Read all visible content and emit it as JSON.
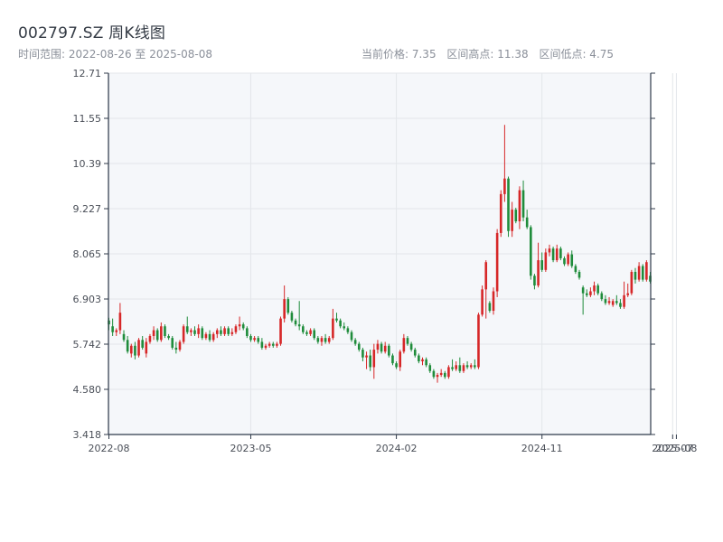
{
  "title": "002797.SZ 周K线图",
  "subtitle": {
    "range_label": "时间范围: 2022-08-26 至 2025-08-08",
    "current_price": "当前价格: 7.35",
    "high": "区间高点: 11.38",
    "low": "区间低点: 4.75"
  },
  "colors": {
    "up": "#d62728",
    "down": "#1f8c3b",
    "plot_bg": "#f5f7fa",
    "grid": "#e3e6ea",
    "axis": "#2f3a4a"
  },
  "chart_data": {
    "type": "candlestick",
    "grid": true,
    "ylim": [
      3.418,
      12.71
    ],
    "y_ticks": [
      "3.418",
      "4.580",
      "5.742",
      "6.903",
      "8.065",
      "9.227",
      "10.39",
      "11.55",
      "12.71"
    ],
    "x_ticks": [
      "2022-08",
      "2023-05",
      "2024-02",
      "2024-11",
      "2025-07",
      "2025-08"
    ],
    "x_tick_weeks": [
      0,
      38,
      77,
      116,
      151,
      152
    ],
    "candles": [
      {
        "o": 6.35,
        "h": 6.42,
        "l": 6.1,
        "c": 6.25
      },
      {
        "o": 6.2,
        "h": 6.4,
        "l": 5.95,
        "c": 6.05
      },
      {
        "o": 6.05,
        "h": 6.15,
        "l": 5.95,
        "c": 6.1
      },
      {
        "o": 6.1,
        "h": 6.8,
        "l": 6.0,
        "c": 6.55
      },
      {
        "o": 6.0,
        "h": 6.1,
        "l": 5.8,
        "c": 5.85
      },
      {
        "o": 5.85,
        "h": 5.95,
        "l": 5.5,
        "c": 5.55
      },
      {
        "o": 5.5,
        "h": 5.75,
        "l": 5.4,
        "c": 5.7
      },
      {
        "o": 5.7,
        "h": 5.8,
        "l": 5.35,
        "c": 5.45
      },
      {
        "o": 5.45,
        "h": 5.9,
        "l": 5.4,
        "c": 5.85
      },
      {
        "o": 5.85,
        "h": 5.95,
        "l": 5.6,
        "c": 5.65
      },
      {
        "o": 5.5,
        "h": 5.9,
        "l": 5.4,
        "c": 5.8
      },
      {
        "o": 5.8,
        "h": 6.0,
        "l": 5.75,
        "c": 5.95
      },
      {
        "o": 5.95,
        "h": 6.2,
        "l": 5.85,
        "c": 6.1
      },
      {
        "o": 6.1,
        "h": 6.15,
        "l": 5.8,
        "c": 5.85
      },
      {
        "o": 5.85,
        "h": 6.3,
        "l": 5.8,
        "c": 6.2
      },
      {
        "o": 6.2,
        "h": 6.25,
        "l": 5.9,
        "c": 5.95
      },
      {
        "o": 5.95,
        "h": 6.0,
        "l": 5.85,
        "c": 5.9
      },
      {
        "o": 5.9,
        "h": 5.95,
        "l": 5.6,
        "c": 5.65
      },
      {
        "o": 5.65,
        "h": 5.8,
        "l": 5.5,
        "c": 5.6
      },
      {
        "o": 5.6,
        "h": 5.85,
        "l": 5.55,
        "c": 5.8
      },
      {
        "o": 5.8,
        "h": 6.25,
        "l": 5.75,
        "c": 6.2
      },
      {
        "o": 6.2,
        "h": 6.45,
        "l": 6.0,
        "c": 6.05
      },
      {
        "o": 6.05,
        "h": 6.15,
        "l": 5.95,
        "c": 6.1
      },
      {
        "o": 6.1,
        "h": 6.2,
        "l": 5.95,
        "c": 6.0
      },
      {
        "o": 6.0,
        "h": 6.25,
        "l": 5.9,
        "c": 6.15
      },
      {
        "o": 6.15,
        "h": 6.2,
        "l": 5.85,
        "c": 5.9
      },
      {
        "o": 5.9,
        "h": 6.05,
        "l": 5.85,
        "c": 6.0
      },
      {
        "o": 6.0,
        "h": 6.1,
        "l": 5.8,
        "c": 5.85
      },
      {
        "o": 5.85,
        "h": 6.05,
        "l": 5.8,
        "c": 6.0
      },
      {
        "o": 6.0,
        "h": 6.15,
        "l": 5.9,
        "c": 6.1
      },
      {
        "o": 6.1,
        "h": 6.2,
        "l": 5.95,
        "c": 6.0
      },
      {
        "o": 6.0,
        "h": 6.2,
        "l": 5.95,
        "c": 6.15
      },
      {
        "o": 6.15,
        "h": 6.2,
        "l": 5.95,
        "c": 6.0
      },
      {
        "o": 6.0,
        "h": 6.15,
        "l": 5.95,
        "c": 6.05
      },
      {
        "o": 6.05,
        "h": 6.25,
        "l": 6.0,
        "c": 6.2
      },
      {
        "o": 6.2,
        "h": 6.45,
        "l": 6.1,
        "c": 6.25
      },
      {
        "o": 6.25,
        "h": 6.3,
        "l": 6.1,
        "c": 6.15
      },
      {
        "o": 6.15,
        "h": 6.2,
        "l": 5.9,
        "c": 5.95
      },
      {
        "o": 5.95,
        "h": 6.0,
        "l": 5.8,
        "c": 5.85
      },
      {
        "o": 5.85,
        "h": 5.95,
        "l": 5.8,
        "c": 5.9
      },
      {
        "o": 5.9,
        "h": 5.95,
        "l": 5.75,
        "c": 5.8
      },
      {
        "o": 5.8,
        "h": 5.9,
        "l": 5.6,
        "c": 5.65
      },
      {
        "o": 5.65,
        "h": 5.75,
        "l": 5.6,
        "c": 5.7
      },
      {
        "o": 5.7,
        "h": 5.8,
        "l": 5.65,
        "c": 5.75
      },
      {
        "o": 5.75,
        "h": 5.8,
        "l": 5.65,
        "c": 5.7
      },
      {
        "o": 5.7,
        "h": 5.8,
        "l": 5.65,
        "c": 5.75
      },
      {
        "o": 5.75,
        "h": 6.45,
        "l": 5.7,
        "c": 6.4
      },
      {
        "o": 6.4,
        "h": 7.25,
        "l": 6.3,
        "c": 6.9
      },
      {
        "o": 6.9,
        "h": 6.95,
        "l": 6.5,
        "c": 6.55
      },
      {
        "o": 6.55,
        "h": 6.6,
        "l": 6.3,
        "c": 6.35
      },
      {
        "o": 6.35,
        "h": 6.4,
        "l": 6.2,
        "c": 6.25
      },
      {
        "o": 6.25,
        "h": 6.85,
        "l": 6.1,
        "c": 6.2
      },
      {
        "o": 6.2,
        "h": 6.25,
        "l": 6.0,
        "c": 6.05
      },
      {
        "o": 6.05,
        "h": 6.1,
        "l": 5.95,
        "c": 6.0
      },
      {
        "o": 6.0,
        "h": 6.15,
        "l": 5.95,
        "c": 6.1
      },
      {
        "o": 6.1,
        "h": 6.15,
        "l": 5.85,
        "c": 5.9
      },
      {
        "o": 5.9,
        "h": 5.95,
        "l": 5.75,
        "c": 5.8
      },
      {
        "o": 5.8,
        "h": 5.95,
        "l": 5.7,
        "c": 5.9
      },
      {
        "o": 5.9,
        "h": 6.0,
        "l": 5.75,
        "c": 5.8
      },
      {
        "o": 5.8,
        "h": 5.95,
        "l": 5.75,
        "c": 5.9
      },
      {
        "o": 5.9,
        "h": 6.65,
        "l": 5.85,
        "c": 6.4
      },
      {
        "o": 6.4,
        "h": 6.55,
        "l": 6.3,
        "c": 6.35
      },
      {
        "o": 6.35,
        "h": 6.4,
        "l": 6.15,
        "c": 6.2
      },
      {
        "o": 6.2,
        "h": 6.3,
        "l": 6.1,
        "c": 6.15
      },
      {
        "o": 6.15,
        "h": 6.2,
        "l": 6.0,
        "c": 6.05
      },
      {
        "o": 6.05,
        "h": 6.1,
        "l": 5.8,
        "c": 5.85
      },
      {
        "o": 5.85,
        "h": 5.9,
        "l": 5.7,
        "c": 5.75
      },
      {
        "o": 5.75,
        "h": 5.8,
        "l": 5.55,
        "c": 5.6
      },
      {
        "o": 5.6,
        "h": 5.65,
        "l": 5.3,
        "c": 5.4
      },
      {
        "o": 5.4,
        "h": 5.55,
        "l": 5.1,
        "c": 5.45
      },
      {
        "o": 5.45,
        "h": 5.6,
        "l": 5.05,
        "c": 5.15
      },
      {
        "o": 5.15,
        "h": 5.75,
        "l": 4.85,
        "c": 5.6
      },
      {
        "o": 5.6,
        "h": 5.85,
        "l": 5.5,
        "c": 5.75
      },
      {
        "o": 5.75,
        "h": 5.8,
        "l": 5.5,
        "c": 5.55
      },
      {
        "o": 5.55,
        "h": 5.8,
        "l": 5.5,
        "c": 5.7
      },
      {
        "o": 5.7,
        "h": 5.75,
        "l": 5.4,
        "c": 5.45
      },
      {
        "o": 5.45,
        "h": 5.5,
        "l": 5.2,
        "c": 5.25
      },
      {
        "o": 5.25,
        "h": 5.3,
        "l": 5.1,
        "c": 5.15
      },
      {
        "o": 5.15,
        "h": 5.6,
        "l": 5.05,
        "c": 5.55
      },
      {
        "o": 5.55,
        "h": 6.0,
        "l": 5.5,
        "c": 5.9
      },
      {
        "o": 5.9,
        "h": 5.95,
        "l": 5.7,
        "c": 5.75
      },
      {
        "o": 5.75,
        "h": 5.8,
        "l": 5.55,
        "c": 5.6
      },
      {
        "o": 5.6,
        "h": 5.65,
        "l": 5.4,
        "c": 5.45
      },
      {
        "o": 5.45,
        "h": 5.5,
        "l": 5.25,
        "c": 5.3
      },
      {
        "o": 5.3,
        "h": 5.4,
        "l": 5.2,
        "c": 5.35
      },
      {
        "o": 5.35,
        "h": 5.4,
        "l": 5.15,
        "c": 5.2
      },
      {
        "o": 5.2,
        "h": 5.25,
        "l": 5.0,
        "c": 5.05
      },
      {
        "o": 5.05,
        "h": 5.1,
        "l": 4.85,
        "c": 4.9
      },
      {
        "o": 4.9,
        "h": 5.0,
        "l": 4.75,
        "c": 4.95
      },
      {
        "o": 4.95,
        "h": 5.1,
        "l": 4.9,
        "c": 5.0
      },
      {
        "o": 5.0,
        "h": 5.05,
        "l": 4.85,
        "c": 4.9
      },
      {
        "o": 4.9,
        "h": 5.2,
        "l": 4.85,
        "c": 5.15
      },
      {
        "o": 5.15,
        "h": 5.35,
        "l": 5.05,
        "c": 5.1
      },
      {
        "o": 5.1,
        "h": 5.3,
        "l": 5.05,
        "c": 5.2
      },
      {
        "o": 5.2,
        "h": 5.4,
        "l": 5.0,
        "c": 5.05
      },
      {
        "o": 5.05,
        "h": 5.25,
        "l": 5.0,
        "c": 5.2
      },
      {
        "o": 5.2,
        "h": 5.3,
        "l": 5.1,
        "c": 5.15
      },
      {
        "o": 5.15,
        "h": 5.25,
        "l": 5.1,
        "c": 5.2
      },
      {
        "o": 5.2,
        "h": 5.35,
        "l": 5.1,
        "c": 5.15
      },
      {
        "o": 5.15,
        "h": 6.55,
        "l": 5.1,
        "c": 6.5
      },
      {
        "o": 6.5,
        "h": 7.25,
        "l": 6.45,
        "c": 7.15
      },
      {
        "o": 7.15,
        "h": 7.9,
        "l": 6.4,
        "c": 7.85
      },
      {
        "o": 6.8,
        "h": 6.85,
        "l": 6.55,
        "c": 6.6
      },
      {
        "o": 6.6,
        "h": 7.2,
        "l": 6.5,
        "c": 7.1
      },
      {
        "o": 7.1,
        "h": 8.7,
        "l": 6.95,
        "c": 8.6
      },
      {
        "o": 8.6,
        "h": 9.7,
        "l": 8.5,
        "c": 9.6
      },
      {
        "o": 9.6,
        "h": 11.38,
        "l": 9.4,
        "c": 10.0
      },
      {
        "o": 10.0,
        "h": 10.05,
        "l": 8.5,
        "c": 8.65
      },
      {
        "o": 8.65,
        "h": 9.4,
        "l": 8.5,
        "c": 9.2
      },
      {
        "o": 9.2,
        "h": 9.25,
        "l": 8.85,
        "c": 8.9
      },
      {
        "o": 8.9,
        "h": 9.8,
        "l": 8.7,
        "c": 9.7
      },
      {
        "o": 9.7,
        "h": 9.95,
        "l": 8.9,
        "c": 9.0
      },
      {
        "o": 9.0,
        "h": 9.2,
        "l": 8.7,
        "c": 8.75
      },
      {
        "o": 8.75,
        "h": 8.8,
        "l": 7.4,
        "c": 7.5
      },
      {
        "o": 7.5,
        "h": 7.55,
        "l": 7.15,
        "c": 7.25
      },
      {
        "o": 7.25,
        "h": 8.35,
        "l": 7.2,
        "c": 7.9
      },
      {
        "o": 7.9,
        "h": 8.1,
        "l": 7.6,
        "c": 7.65
      },
      {
        "o": 7.65,
        "h": 8.2,
        "l": 7.6,
        "c": 8.1
      },
      {
        "o": 8.1,
        "h": 8.3,
        "l": 8.0,
        "c": 8.2
      },
      {
        "o": 8.2,
        "h": 8.25,
        "l": 7.85,
        "c": 7.9
      },
      {
        "o": 7.9,
        "h": 8.3,
        "l": 7.85,
        "c": 8.2
      },
      {
        "o": 8.2,
        "h": 8.25,
        "l": 7.9,
        "c": 7.95
      },
      {
        "o": 7.95,
        "h": 8.0,
        "l": 7.75,
        "c": 7.8
      },
      {
        "o": 7.8,
        "h": 8.1,
        "l": 7.75,
        "c": 8.05
      },
      {
        "o": 8.05,
        "h": 8.15,
        "l": 7.7,
        "c": 7.75
      },
      {
        "o": 7.75,
        "h": 7.8,
        "l": 7.55,
        "c": 7.6
      },
      {
        "o": 7.6,
        "h": 7.65,
        "l": 7.4,
        "c": 7.45
      },
      {
        "o": 7.2,
        "h": 7.25,
        "l": 6.5,
        "c": 7.05
      },
      {
        "o": 7.05,
        "h": 7.15,
        "l": 6.95,
        "c": 7.0
      },
      {
        "o": 7.0,
        "h": 7.2,
        "l": 6.95,
        "c": 7.1
      },
      {
        "o": 7.1,
        "h": 7.35,
        "l": 7.0,
        "c": 7.25
      },
      {
        "o": 7.25,
        "h": 7.3,
        "l": 7.0,
        "c": 7.05
      },
      {
        "o": 7.05,
        "h": 7.1,
        "l": 6.85,
        "c": 6.9
      },
      {
        "o": 6.9,
        "h": 7.0,
        "l": 6.75,
        "c": 6.8
      },
      {
        "o": 6.8,
        "h": 6.95,
        "l": 6.75,
        "c": 6.85
      },
      {
        "o": 6.75,
        "h": 6.9,
        "l": 6.7,
        "c": 6.85
      },
      {
        "o": 6.85,
        "h": 7.0,
        "l": 6.75,
        "c": 6.8
      },
      {
        "o": 6.8,
        "h": 6.9,
        "l": 6.65,
        "c": 6.7
      },
      {
        "o": 6.7,
        "h": 7.35,
        "l": 6.65,
        "c": 7.0
      },
      {
        "o": 7.0,
        "h": 7.3,
        "l": 6.95,
        "c": 7.05
      },
      {
        "o": 7.05,
        "h": 7.65,
        "l": 7.0,
        "c": 7.6
      },
      {
        "o": 7.6,
        "h": 7.7,
        "l": 7.3,
        "c": 7.4
      },
      {
        "o": 7.4,
        "h": 7.85,
        "l": 7.35,
        "c": 7.75
      },
      {
        "o": 7.75,
        "h": 7.8,
        "l": 7.35,
        "c": 7.4
      },
      {
        "o": 7.4,
        "h": 7.9,
        "l": 7.35,
        "c": 7.85
      },
      {
        "o": 7.5,
        "h": 7.6,
        "l": 7.3,
        "c": 7.35
      }
    ]
  }
}
